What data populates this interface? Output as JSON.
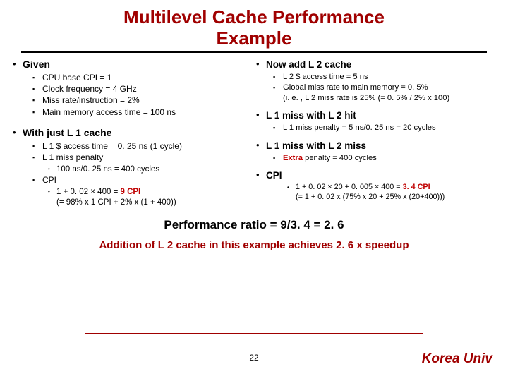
{
  "title_line1": "Multilevel Cache Performance",
  "title_line2": "Example",
  "left": {
    "given": "Given",
    "g1": "CPU base CPI = 1",
    "g2": "Clock frequency = 4 GHz",
    "g3": "Miss rate/instruction = 2%",
    "g4": "Main memory access time = 100 ns",
    "withL1": "With just L 1 cache",
    "w1": "L 1 $ access time = 0. 25 ns (1 cycle)",
    "w2": "L 1 miss penalty",
    "w2a": "100 ns/0. 25 ns = 400 cycles",
    "cpi": "CPI",
    "cpi_a_pre": "1 + 0. 02 × 400 = ",
    "cpi_a_red": "9 CPI",
    "cpi_b": "(= 98% x 1 CPI + 2% x (1 + 400))"
  },
  "right": {
    "addL2": "Now add L 2 cache",
    "a1": "L 2 $ access time = 5 ns",
    "a2": "Global miss rate to main memory = 0. 5%",
    "a2b": "(i. e. , L 2 miss rate is 25% (= 0. 5% / 2% x 100)",
    "l1hit": "L 1 miss with L 2 hit",
    "h1": "L 1 miss penalty = 5 ns/0. 25 ns = 20 cycles",
    "l1miss": "L 1 miss with L 2 miss",
    "m1_pre": "Extra",
    "m1_post": " penalty = 400 cycles",
    "cpi": "CPI",
    "cpi_a_pre": "1 + 0. 02 × 20 + 0. 005 × 400 = ",
    "cpi_a_red": "3. 4 CPI",
    "cpi_b": "(= 1 + 0. 02 x (75% x 20 + 25% x (20+400)))"
  },
  "concl1": "Performance ratio = 9/3. 4 = 2. 6",
  "concl2": "Addition of L 2 cache in this example achieves 2. 6 x speedup",
  "page": "22",
  "brand": "Korea Univ"
}
